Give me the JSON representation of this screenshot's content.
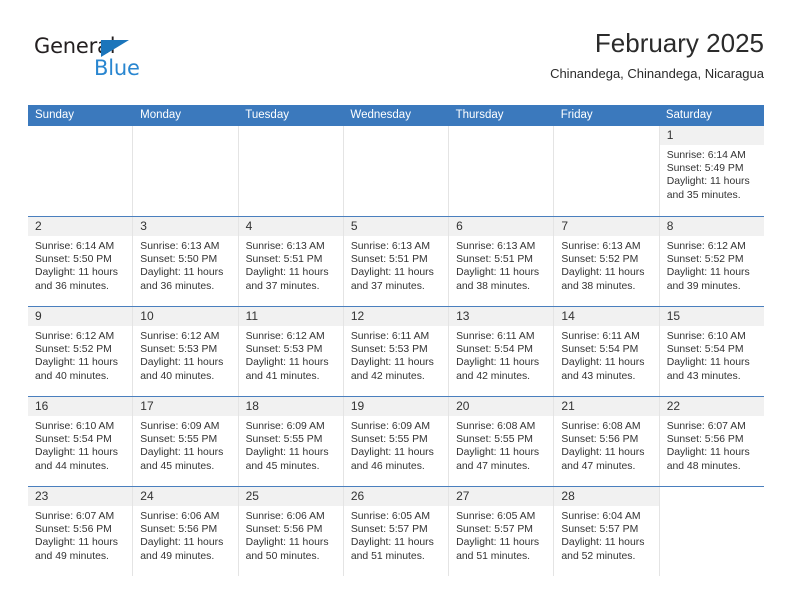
{
  "brand": {
    "name_primary": "General",
    "name_secondary": "Blue",
    "triangle_color": "#1b75bb",
    "secondary_color": "#2986d0"
  },
  "header": {
    "title": "February 2025",
    "subtitle": "Chinandega, Chinandega, Nicaragua"
  },
  "theme": {
    "header_blue": "#3b79bd",
    "row_rule_blue": "#4a7fbe",
    "day_band_gray": "#f1f1f1",
    "text_color": "#333333"
  },
  "weekdays": [
    "Sunday",
    "Monday",
    "Tuesday",
    "Wednesday",
    "Thursday",
    "Friday",
    "Saturday"
  ],
  "weeks": [
    [
      {
        "day": "",
        "blank": true
      },
      {
        "day": "",
        "blank": true
      },
      {
        "day": "",
        "blank": true
      },
      {
        "day": "",
        "blank": true
      },
      {
        "day": "",
        "blank": true
      },
      {
        "day": "",
        "blank": true
      },
      {
        "day": "1",
        "sunrise": "Sunrise: 6:14 AM",
        "sunset": "Sunset: 5:49 PM",
        "daylight1": "Daylight: 11 hours",
        "daylight2": "and 35 minutes."
      }
    ],
    [
      {
        "day": "2",
        "sunrise": "Sunrise: 6:14 AM",
        "sunset": "Sunset: 5:50 PM",
        "daylight1": "Daylight: 11 hours",
        "daylight2": "and 36 minutes."
      },
      {
        "day": "3",
        "sunrise": "Sunrise: 6:13 AM",
        "sunset": "Sunset: 5:50 PM",
        "daylight1": "Daylight: 11 hours",
        "daylight2": "and 36 minutes."
      },
      {
        "day": "4",
        "sunrise": "Sunrise: 6:13 AM",
        "sunset": "Sunset: 5:51 PM",
        "daylight1": "Daylight: 11 hours",
        "daylight2": "and 37 minutes."
      },
      {
        "day": "5",
        "sunrise": "Sunrise: 6:13 AM",
        "sunset": "Sunset: 5:51 PM",
        "daylight1": "Daylight: 11 hours",
        "daylight2": "and 37 minutes."
      },
      {
        "day": "6",
        "sunrise": "Sunrise: 6:13 AM",
        "sunset": "Sunset: 5:51 PM",
        "daylight1": "Daylight: 11 hours",
        "daylight2": "and 38 minutes."
      },
      {
        "day": "7",
        "sunrise": "Sunrise: 6:13 AM",
        "sunset": "Sunset: 5:52 PM",
        "daylight1": "Daylight: 11 hours",
        "daylight2": "and 38 minutes."
      },
      {
        "day": "8",
        "sunrise": "Sunrise: 6:12 AM",
        "sunset": "Sunset: 5:52 PM",
        "daylight1": "Daylight: 11 hours",
        "daylight2": "and 39 minutes."
      }
    ],
    [
      {
        "day": "9",
        "sunrise": "Sunrise: 6:12 AM",
        "sunset": "Sunset: 5:52 PM",
        "daylight1": "Daylight: 11 hours",
        "daylight2": "and 40 minutes."
      },
      {
        "day": "10",
        "sunrise": "Sunrise: 6:12 AM",
        "sunset": "Sunset: 5:53 PM",
        "daylight1": "Daylight: 11 hours",
        "daylight2": "and 40 minutes."
      },
      {
        "day": "11",
        "sunrise": "Sunrise: 6:12 AM",
        "sunset": "Sunset: 5:53 PM",
        "daylight1": "Daylight: 11 hours",
        "daylight2": "and 41 minutes."
      },
      {
        "day": "12",
        "sunrise": "Sunrise: 6:11 AM",
        "sunset": "Sunset: 5:53 PM",
        "daylight1": "Daylight: 11 hours",
        "daylight2": "and 42 minutes."
      },
      {
        "day": "13",
        "sunrise": "Sunrise: 6:11 AM",
        "sunset": "Sunset: 5:54 PM",
        "daylight1": "Daylight: 11 hours",
        "daylight2": "and 42 minutes."
      },
      {
        "day": "14",
        "sunrise": "Sunrise: 6:11 AM",
        "sunset": "Sunset: 5:54 PM",
        "daylight1": "Daylight: 11 hours",
        "daylight2": "and 43 minutes."
      },
      {
        "day": "15",
        "sunrise": "Sunrise: 6:10 AM",
        "sunset": "Sunset: 5:54 PM",
        "daylight1": "Daylight: 11 hours",
        "daylight2": "and 43 minutes."
      }
    ],
    [
      {
        "day": "16",
        "sunrise": "Sunrise: 6:10 AM",
        "sunset": "Sunset: 5:54 PM",
        "daylight1": "Daylight: 11 hours",
        "daylight2": "and 44 minutes."
      },
      {
        "day": "17",
        "sunrise": "Sunrise: 6:09 AM",
        "sunset": "Sunset: 5:55 PM",
        "daylight1": "Daylight: 11 hours",
        "daylight2": "and 45 minutes."
      },
      {
        "day": "18",
        "sunrise": "Sunrise: 6:09 AM",
        "sunset": "Sunset: 5:55 PM",
        "daylight1": "Daylight: 11 hours",
        "daylight2": "and 45 minutes."
      },
      {
        "day": "19",
        "sunrise": "Sunrise: 6:09 AM",
        "sunset": "Sunset: 5:55 PM",
        "daylight1": "Daylight: 11 hours",
        "daylight2": "and 46 minutes."
      },
      {
        "day": "20",
        "sunrise": "Sunrise: 6:08 AM",
        "sunset": "Sunset: 5:55 PM",
        "daylight1": "Daylight: 11 hours",
        "daylight2": "and 47 minutes."
      },
      {
        "day": "21",
        "sunrise": "Sunrise: 6:08 AM",
        "sunset": "Sunset: 5:56 PM",
        "daylight1": "Daylight: 11 hours",
        "daylight2": "and 47 minutes."
      },
      {
        "day": "22",
        "sunrise": "Sunrise: 6:07 AM",
        "sunset": "Sunset: 5:56 PM",
        "daylight1": "Daylight: 11 hours",
        "daylight2": "and 48 minutes."
      }
    ],
    [
      {
        "day": "23",
        "sunrise": "Sunrise: 6:07 AM",
        "sunset": "Sunset: 5:56 PM",
        "daylight1": "Daylight: 11 hours",
        "daylight2": "and 49 minutes."
      },
      {
        "day": "24",
        "sunrise": "Sunrise: 6:06 AM",
        "sunset": "Sunset: 5:56 PM",
        "daylight1": "Daylight: 11 hours",
        "daylight2": "and 49 minutes."
      },
      {
        "day": "25",
        "sunrise": "Sunrise: 6:06 AM",
        "sunset": "Sunset: 5:56 PM",
        "daylight1": "Daylight: 11 hours",
        "daylight2": "and 50 minutes."
      },
      {
        "day": "26",
        "sunrise": "Sunrise: 6:05 AM",
        "sunset": "Sunset: 5:57 PM",
        "daylight1": "Daylight: 11 hours",
        "daylight2": "and 51 minutes."
      },
      {
        "day": "27",
        "sunrise": "Sunrise: 6:05 AM",
        "sunset": "Sunset: 5:57 PM",
        "daylight1": "Daylight: 11 hours",
        "daylight2": "and 51 minutes."
      },
      {
        "day": "28",
        "sunrise": "Sunrise: 6:04 AM",
        "sunset": "Sunset: 5:57 PM",
        "daylight1": "Daylight: 11 hours",
        "daylight2": "and 52 minutes."
      },
      {
        "day": "",
        "blank": true
      }
    ]
  ]
}
